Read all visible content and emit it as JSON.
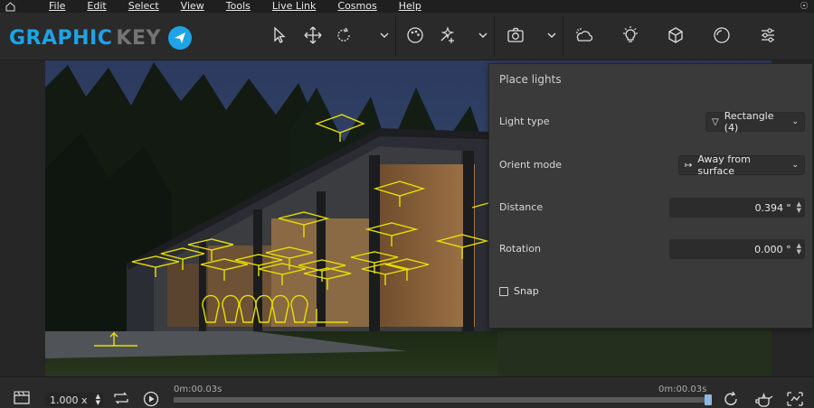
{
  "menubar": {
    "items": [
      "File",
      "Edit",
      "Select",
      "View",
      "Tools",
      "Live Link",
      "Cosmos",
      "Help"
    ]
  },
  "logo": {
    "text_part1": "GRAPHIC",
    "text_part2": "KEY",
    "color": "#1ea3e6"
  },
  "toolbar": {
    "icons": [
      "home-icon",
      "select-arrow-icon",
      "move-icon",
      "rotate-icon",
      "chevron-down-icon",
      "material-palette-icon",
      "add-material-icon",
      "camera-icon",
      "lighting-env-icon",
      "light-bulb-icon",
      "cube-icon",
      "circle-icon",
      "sliders-icon"
    ]
  },
  "panel": {
    "title": "Place lights",
    "light_type_label": "Light type",
    "light_type_value": "Rectangle (4)",
    "orient_mode_label": "Orient mode",
    "orient_mode_value": "Away from surface",
    "distance_label": "Distance",
    "distance_value": "0.394 \"",
    "rotation_label": "Rotation",
    "rotation_value": "0.000 °",
    "snap_label": "Snap",
    "snap_checked": false
  },
  "bottombar": {
    "speed": "1.000 x",
    "time_start": "0m:00.03s",
    "time_end": "0m:00.03s",
    "timeline_progress": 0.995
  },
  "colors": {
    "accent": "#1ea3e6",
    "light_gizmo": "#e8e000",
    "panel_bg": "#3a3a3a"
  }
}
